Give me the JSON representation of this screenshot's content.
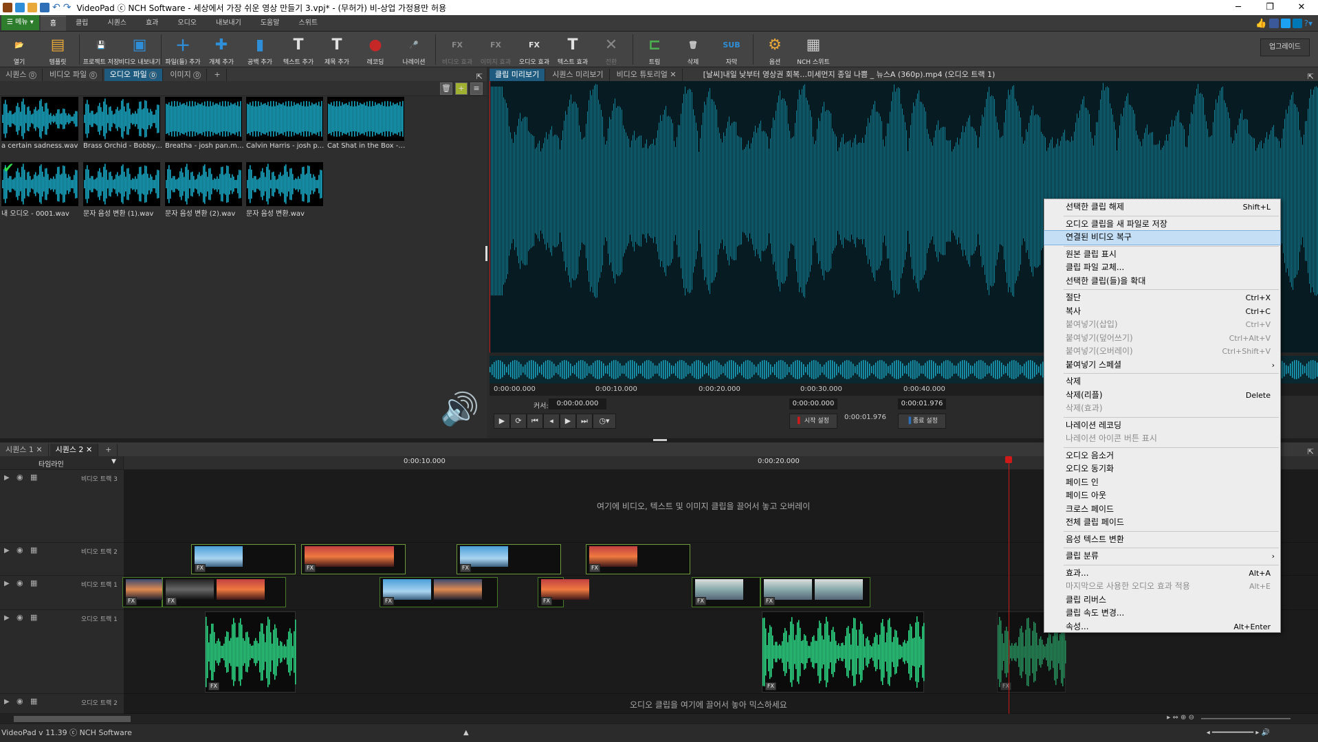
{
  "window": {
    "title": "VideoPad ⓒ NCH Software - 세상에서 가장 쉬운 영상 만들기 3.vpj* - (무허가) 비-상업 가정용만 허용"
  },
  "menu_tabs": {
    "menu_button": "메뉴",
    "tabs": [
      "홈",
      "클립",
      "시퀀스",
      "효과",
      "오디오",
      "내보내기",
      "도움말",
      "스위트"
    ]
  },
  "ribbon": {
    "buttons": [
      {
        "label": "열기",
        "icon": "folder-open-icon",
        "color": "#e8a83a"
      },
      {
        "label": "템플릿",
        "icon": "template-icon",
        "color": "#e8a83a"
      },
      {
        "label": "프로젝트 저장",
        "icon": "save-icon",
        "color": "#2e8fd8"
      },
      {
        "label": "비디오 내보내기",
        "icon": "export-video-icon",
        "color": "#2e8fd8"
      },
      {
        "label": "파일(들) 추가",
        "icon": "add-files-icon",
        "color": "#2e8fd8"
      },
      {
        "label": "개체 추가",
        "icon": "add-object-icon",
        "color": "#2e8fd8"
      },
      {
        "label": "공백 추가",
        "icon": "add-blank-icon",
        "color": "#2e8fd8"
      },
      {
        "label": "텍스트 추가",
        "icon": "add-text-icon",
        "color": "#e0e0e0"
      },
      {
        "label": "제목 추가",
        "icon": "add-title-icon",
        "color": "#e0e0e0"
      },
      {
        "label": "레코딩",
        "icon": "record-icon",
        "color": "#c62828"
      },
      {
        "label": "나레이션",
        "icon": "microphone-icon",
        "color": "#bbbbbb"
      },
      {
        "label": "비디오 효과",
        "icon": "video-effects-icon",
        "color": "#888888",
        "disabled": true
      },
      {
        "label": "이미지 효과",
        "icon": "image-effects-icon",
        "color": "#888888",
        "disabled": true
      },
      {
        "label": "오디오 효과",
        "icon": "audio-effects-icon",
        "color": "#e0e0e0"
      },
      {
        "label": "텍스트 효과",
        "icon": "text-effects-icon",
        "color": "#e0e0e0"
      },
      {
        "label": "전환",
        "icon": "transition-icon",
        "color": "#888888",
        "disabled": true
      },
      {
        "label": "트림",
        "icon": "trim-icon",
        "color": "#4caf50"
      },
      {
        "label": "삭제",
        "icon": "trash-icon",
        "color": "#cccccc"
      },
      {
        "label": "자막",
        "icon": "subtitle-icon",
        "color": "#2e8fd8"
      },
      {
        "label": "옵션",
        "icon": "options-icon",
        "color": "#e8a83a"
      },
      {
        "label": "NCH 스위트",
        "icon": "nch-suite-icon",
        "color": "#cccccc"
      }
    ],
    "upgrade": "업그레이드"
  },
  "bin": {
    "tabs": [
      {
        "label": "시퀀스",
        "count": "0"
      },
      {
        "label": "비디오 파일",
        "count": "0"
      },
      {
        "label": "오디오 파일",
        "count": "0"
      },
      {
        "label": "이미지",
        "count": "0"
      }
    ],
    "add_tab": "+",
    "files": [
      {
        "name": "a certain sadness.wav",
        "checked": false
      },
      {
        "name": "Brass Orchid - Bobby ...",
        "checked": false
      },
      {
        "name": "Breatha - josh pan.mp3",
        "checked": false
      },
      {
        "name": "Calvin Harris - josh p...",
        "checked": false
      },
      {
        "name": "Cat Shat in the Box - J...",
        "checked": false
      },
      {
        "name": "내 오디오 - 0001.wav",
        "checked": true
      },
      {
        "name": "문자 음성 변환 (1).wav",
        "checked": false
      },
      {
        "name": "문자 음성 변환 (2).wav",
        "checked": false
      },
      {
        "name": "문자 음성 변환.wav",
        "checked": false
      }
    ]
  },
  "preview": {
    "tabs": [
      "클립 미리보기",
      "시퀀스 미리보기",
      "비디오 튜토리얼"
    ],
    "clip_title": "[날씨]내일 낮부터 영상권 회복…미세먼지 종일 나쁨 _ 뉴스A (360p).mp4 (오디오 트랙 1)",
    "ruler": [
      "0:00:00.000",
      "0:00:10.000",
      "0:00:20.000",
      "0:00:30.000",
      "0:00:40.000"
    ],
    "cursor_label": "커서:",
    "cursor_value": "0:00:00.000",
    "start_value": "0:00:00.000",
    "start_label": "시작 설정",
    "duration_value": "0:00:01.976",
    "end_value": "0:00:01.976",
    "end_label": "종료 설정"
  },
  "timeline": {
    "tabs": [
      "시퀀스 1",
      "시퀀스 2"
    ],
    "add_tab": "+",
    "label": "타임라인",
    "ruler": [
      "0:00:10.000",
      "0:00:20.000"
    ],
    "tracks": {
      "video3": "비디오 트랙 3",
      "video2": "비디오 트랙 2",
      "video1": "비디오 트랙 1",
      "audio1": "오디오 트랙 1",
      "audio2": "오디오 트랙 2"
    },
    "video_hint": "여기에 비디오, 텍스트 및 이미지 클립을 끌어서 놓고 오버레이",
    "audio_hint": "오디오 클립을 여기에 끌어서 놓아 믹스하세요",
    "fx_badge": "FX"
  },
  "status": {
    "text": "VideoPad v 11.39 ⓒ NCH Software"
  },
  "context_menu": {
    "items": [
      {
        "label": "선택한 클립 해제",
        "shortcut": "Shift+L"
      },
      {
        "sep": true
      },
      {
        "label": "오디오 클립을 새 파일로 저장",
        "shortcut": ""
      },
      {
        "label": "연결된 비디오 복구",
        "shortcut": "",
        "highlighted": true
      },
      {
        "sep": true
      },
      {
        "label": "원본 클립 표시",
        "shortcut": ""
      },
      {
        "label": "클립 파일 교체...",
        "shortcut": ""
      },
      {
        "label": "선택한 클립(들)을 확대",
        "shortcut": ""
      },
      {
        "sep": true
      },
      {
        "label": "절단",
        "shortcut": "Ctrl+X"
      },
      {
        "label": "복사",
        "shortcut": "Ctrl+C"
      },
      {
        "label": "붙여넣기(삽입)",
        "shortcut": "Ctrl+V",
        "disabled": true
      },
      {
        "label": "붙여넣기(덮어쓰기)",
        "shortcut": "Ctrl+Alt+V",
        "disabled": true
      },
      {
        "label": "붙여넣기(오버레이)",
        "shortcut": "Ctrl+Shift+V",
        "disabled": true
      },
      {
        "label": "붙여넣기 스페셜",
        "shortcut": "",
        "submenu": true
      },
      {
        "sep": true
      },
      {
        "label": "삭제",
        "shortcut": ""
      },
      {
        "label": "삭제(리플)",
        "shortcut": "Delete"
      },
      {
        "label": "삭제(효과)",
        "shortcut": "",
        "disabled": true
      },
      {
        "sep": true
      },
      {
        "label": "나레이션 레코딩",
        "shortcut": ""
      },
      {
        "label": "나레이션 아이콘 버튼 표시",
        "shortcut": "",
        "disabled": true
      },
      {
        "sep": true
      },
      {
        "label": "오디오 음소거",
        "shortcut": ""
      },
      {
        "label": "오디오 동기화",
        "shortcut": ""
      },
      {
        "label": "페이드 인",
        "shortcut": ""
      },
      {
        "label": "페이드 아웃",
        "shortcut": ""
      },
      {
        "label": "크로스 페이드",
        "shortcut": ""
      },
      {
        "label": "전체 클립 페이드",
        "shortcut": ""
      },
      {
        "sep": true
      },
      {
        "label": "음성 텍스트 변환",
        "shortcut": ""
      },
      {
        "sep": true
      },
      {
        "label": "클립 분류",
        "shortcut": "",
        "submenu": true
      },
      {
        "sep": true
      },
      {
        "label": "효과...",
        "shortcut": "Alt+A"
      },
      {
        "label": "마지막으로 사용한 오디오 효과 적용",
        "shortcut": "Alt+E",
        "disabled": true
      },
      {
        "label": "클립 리버스",
        "shortcut": ""
      },
      {
        "label": "클립 속도 변경...",
        "shortcut": ""
      },
      {
        "label": "속성...",
        "shortcut": "Alt+Enter"
      }
    ]
  },
  "colors": {
    "accent": "#1f5b7e",
    "waveform": "#19a7c4",
    "audio_clip": "#2ee08a",
    "playhead": "#d01a1a",
    "menu_button": "#2d7d2d"
  }
}
